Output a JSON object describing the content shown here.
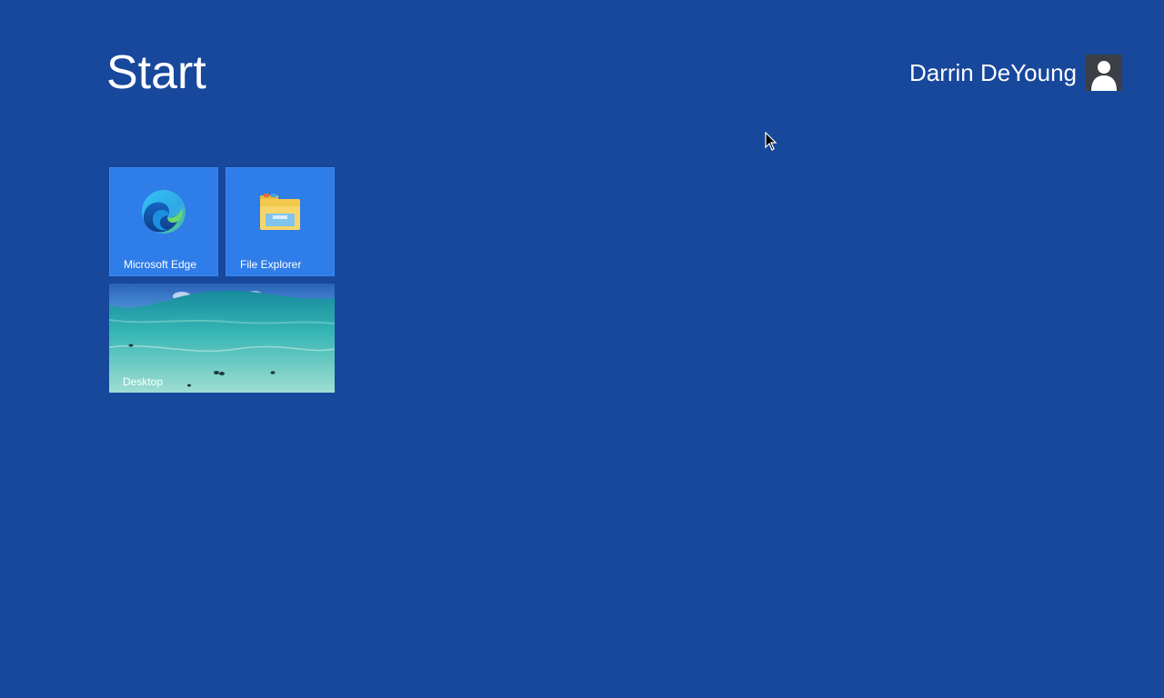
{
  "header": {
    "title": "Start"
  },
  "user": {
    "name": "Darrin DeYoung",
    "avatar_icon": "user-silhouette-icon"
  },
  "tiles": [
    {
      "label": "Microsoft Edge",
      "icon": "edge-icon",
      "color": "#2f7de8"
    },
    {
      "label": "File Explorer",
      "icon": "folder-icon",
      "color": "#2f7de8"
    },
    {
      "label": "Desktop",
      "icon": "desktop-wallpaper",
      "color": "#2fb3b0"
    }
  ],
  "colors": {
    "background": "#17489c",
    "tile": "#2f7de8"
  }
}
